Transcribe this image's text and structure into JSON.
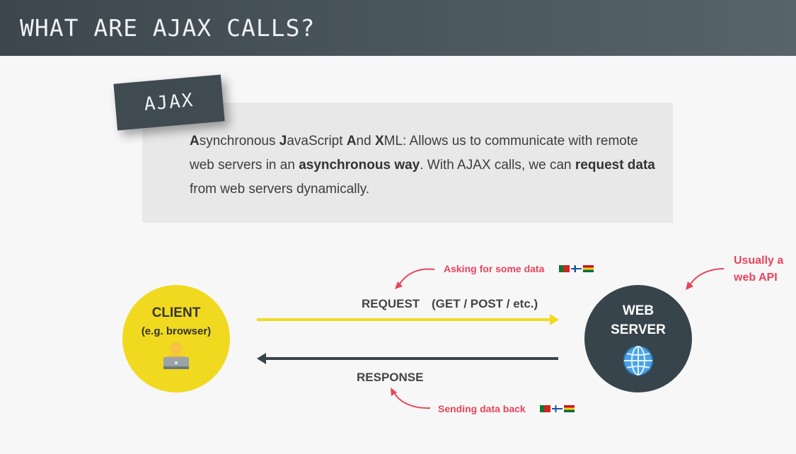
{
  "header": {
    "title": "WHAT ARE AJAX CALLS?"
  },
  "tag": {
    "label": "AJAX"
  },
  "definition": {
    "a_letter": "A",
    "synchronous": "synchronous ",
    "j_letter": "J",
    "avascript": "avaScript ",
    "and_a": "A",
    "nd": "nd ",
    "x_letter": "X",
    "ml_rest": "ML: Allows us to communicate with remote web servers in an ",
    "async_way": "asynchronous way",
    "mid": ". With AJAX calls, we can ",
    "request_data": "request data",
    "end": " from web servers dynamically."
  },
  "client": {
    "title": "CLIENT",
    "subtitle": "(e.g. browser)",
    "icon": "person-with-laptop-icon"
  },
  "server": {
    "title_line1": "WEB",
    "title_line2": "SERVER",
    "icon": "globe-icon"
  },
  "request": {
    "label": "REQUEST",
    "methods": "(GET / POST / etc.)"
  },
  "response": {
    "label": "RESPONSE"
  },
  "notes": {
    "asking": "Asking for some data",
    "sending": "Sending data back",
    "usually_line1": "Usually a",
    "usually_line2": "web API"
  },
  "colors": {
    "header_bg": "#444f56",
    "accent_yellow": "#f1d91f",
    "dark": "#38444b",
    "note_red": "#e8445c"
  }
}
